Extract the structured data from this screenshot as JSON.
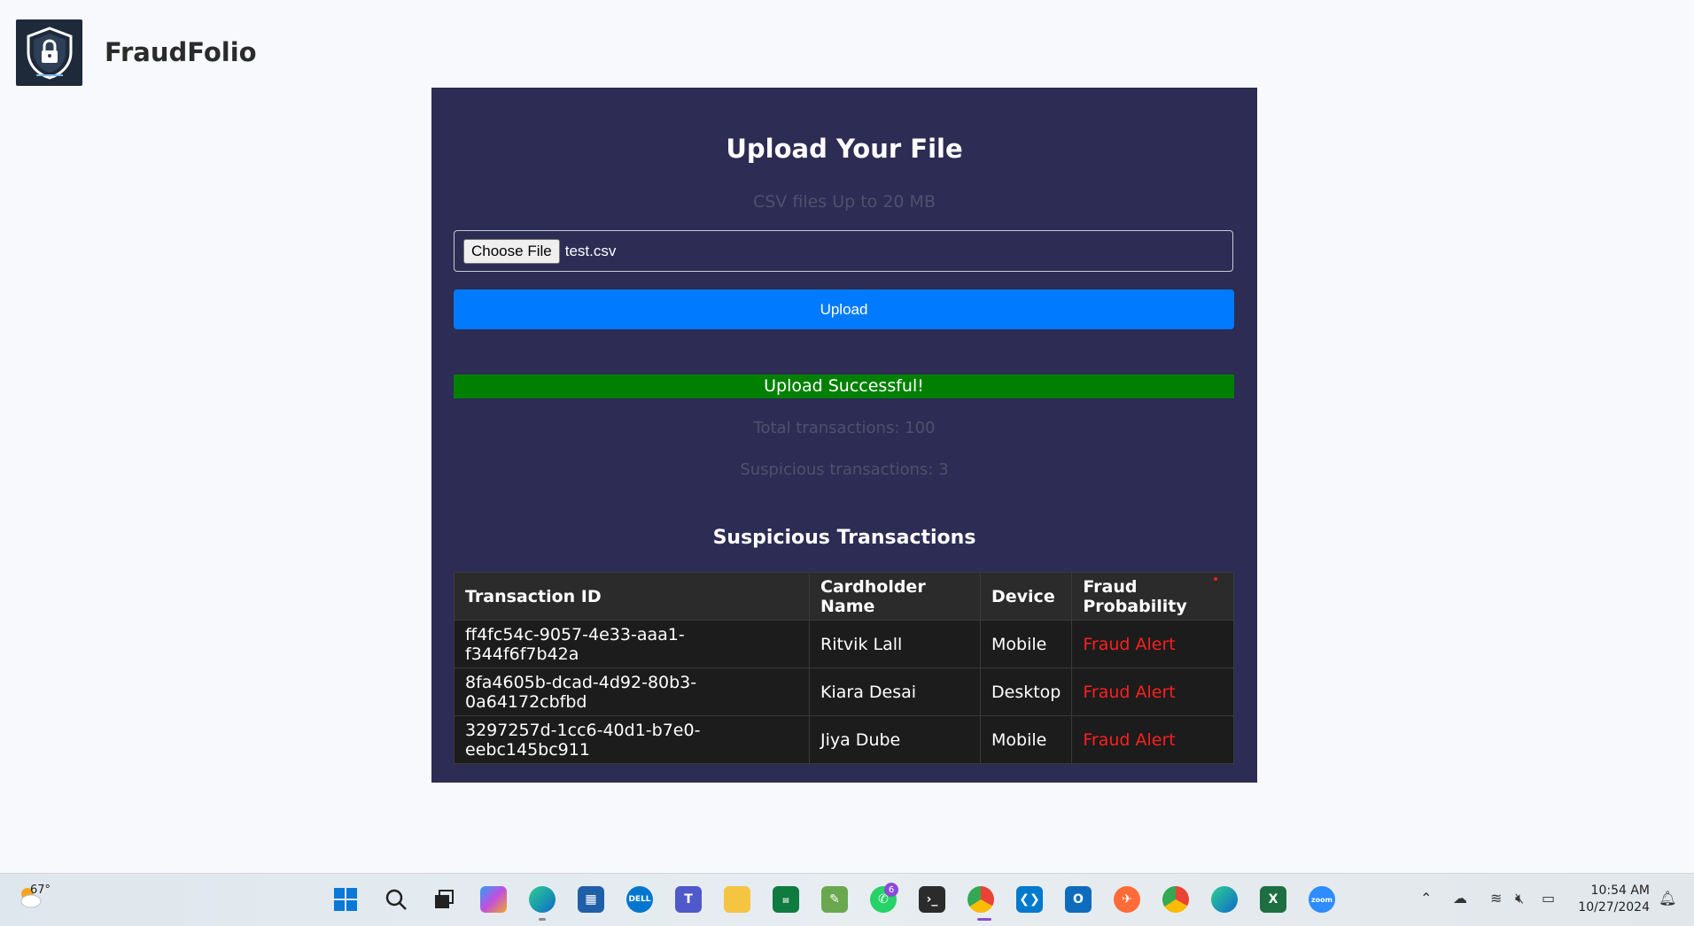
{
  "header": {
    "brand": "FraudFolio"
  },
  "upload": {
    "title": "Upload Your File",
    "subtitle": "CSV files Up to 20 MB",
    "choose_label": "Choose File",
    "file_name": "test.csv",
    "upload_label": "Upload",
    "success_message": "Upload Successful!",
    "total_text": "Total transactions: 100",
    "suspicious_text": "Suspicious transactions: 3"
  },
  "table": {
    "title": "Suspicious Transactions",
    "headers": [
      "Transaction ID",
      "Cardholder Name",
      "Device",
      "Fraud Probability"
    ],
    "rows": [
      [
        "ff4fc54c-9057-4e33-aaa1-f344f6f7b42a",
        "Ritvik Lall",
        "Mobile",
        "Fraud Alert"
      ],
      [
        "8fa4605b-dcad-4d92-80b3-0a64172cbfbd",
        "Kiara Desai",
        "Desktop",
        "Fraud Alert"
      ],
      [
        "3297257d-1cc6-40d1-b7e0-eebc145bc911",
        "Jiya Dube",
        "Mobile",
        "Fraud Alert"
      ]
    ]
  },
  "taskbar": {
    "weather_temp": "67°",
    "whatsapp_badge": "6",
    "time": "10:54 AM",
    "date": "10/27/2024",
    "icons": [
      "start-icon",
      "search-icon",
      "task-view-icon",
      "copilot-icon",
      "edge-icon",
      "store-icon",
      "dell-icon",
      "teams-icon",
      "file-explorer-icon",
      "spreadsheet-app-icon",
      "photo-app-icon",
      "whatsapp-icon",
      "terminal-icon",
      "chrome-icon",
      "vscode-icon",
      "outlook-icon",
      "postman-icon",
      "chrome-profile-icon",
      "edge-profile-icon",
      "excel-icon",
      "zoom-icon"
    ]
  },
  "colors": {
    "card_bg": "#2c2c54",
    "upload_button": "#007bff",
    "success": "#008000",
    "alert": "#ff1f1f"
  }
}
